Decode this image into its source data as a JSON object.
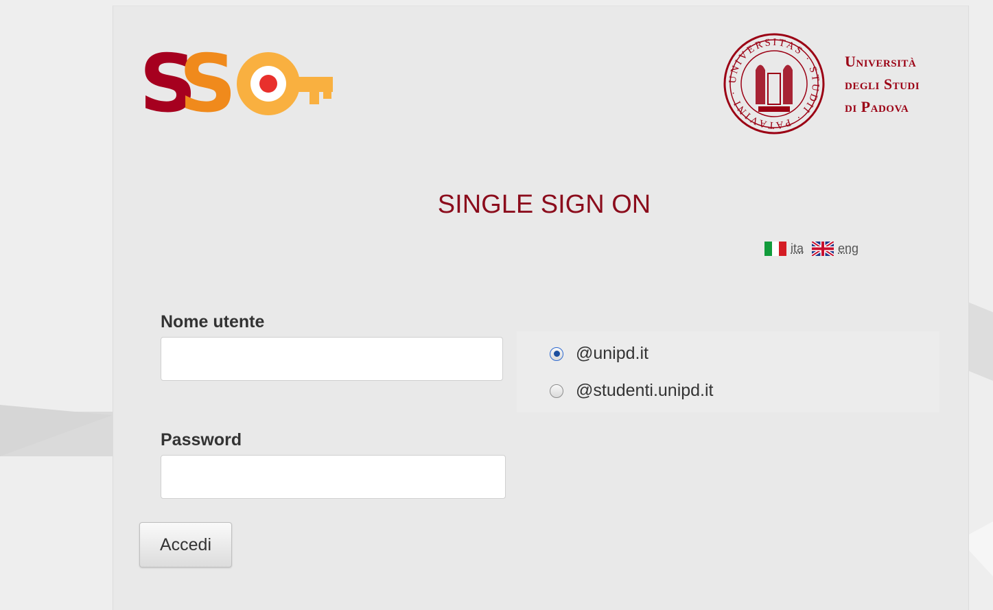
{
  "header": {
    "university_name_lines": [
      "Università",
      "degli Studi",
      "di Padova"
    ]
  },
  "page": {
    "title": "SINGLE SIGN ON"
  },
  "language": {
    "italian_label": "ita",
    "english_label": "eng"
  },
  "form": {
    "username_label": "Nome utente",
    "username_value": "",
    "password_label": "Password",
    "password_value": "",
    "domains": [
      {
        "label": "@unipd.it",
        "checked": true
      },
      {
        "label": "@studenti.unipd.it",
        "checked": false
      }
    ],
    "submit_label": "Accedi"
  },
  "colors": {
    "brand_red": "#9b0014",
    "sso_dark_red": "#a6001f",
    "sso_orange": "#f08a1c",
    "sso_yellow": "#f9b040"
  }
}
